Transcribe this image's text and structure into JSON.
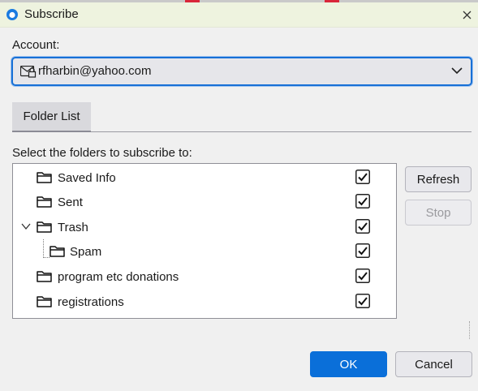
{
  "window": {
    "title": "Subscribe"
  },
  "account": {
    "label": "Account:",
    "selected": "rfharbin@yahoo.com"
  },
  "tabs": [
    {
      "label": "Folder List"
    }
  ],
  "instructions": "Select the folders to subscribe to:",
  "folders": [
    {
      "name": "Saved Info",
      "level": 0,
      "checked": true
    },
    {
      "name": "Sent",
      "level": 0,
      "checked": true
    },
    {
      "name": "Trash",
      "level": 0,
      "expanded": true,
      "checked": true
    },
    {
      "name": "Spam",
      "level": 1,
      "checked": true
    },
    {
      "name": "program etc donations",
      "level": 0,
      "checked": true
    },
    {
      "name": "registrations",
      "level": 0,
      "checked": true
    }
  ],
  "buttons": {
    "refresh": "Refresh",
    "stop": "Stop",
    "ok": "OK",
    "cancel": "Cancel"
  },
  "colors": {
    "accent": "#0a6fd9",
    "titlebar": "#eef3df"
  },
  "icons": {
    "app": "app-icon",
    "close": "close-icon",
    "folder": "folder-icon",
    "account": "account-icon",
    "dropdown": "chevron-down-icon",
    "expand": "chevron-down-icon"
  }
}
